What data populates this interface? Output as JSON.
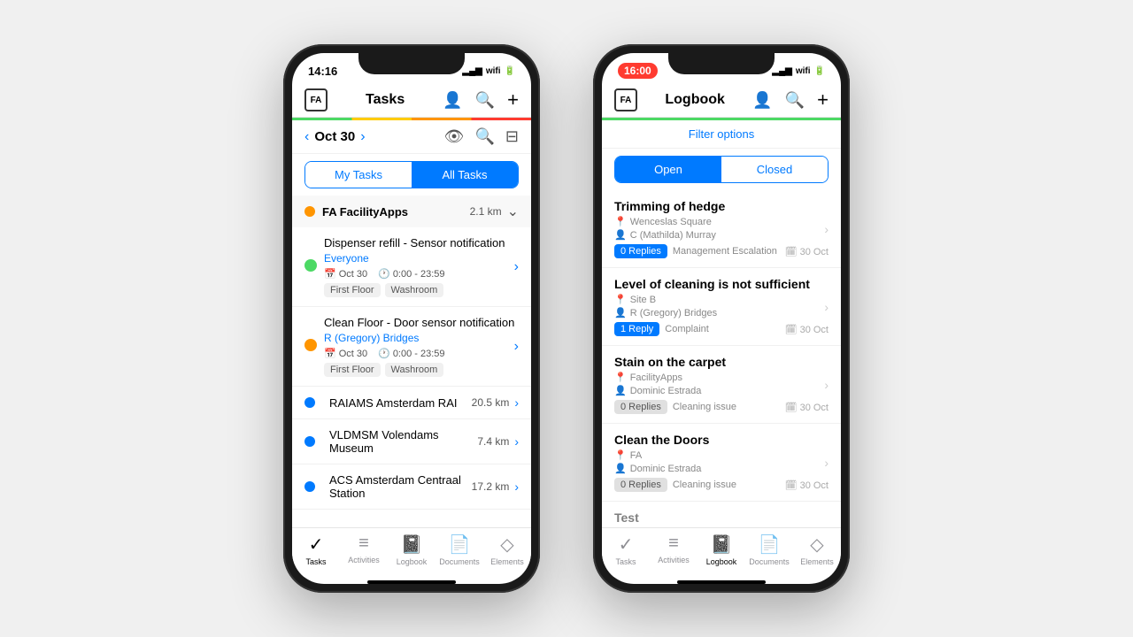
{
  "phone1": {
    "statusBar": {
      "time": "14:16",
      "signal": "●●●",
      "wifi": "wifi",
      "battery": "battery"
    },
    "nav": {
      "title": "Tasks",
      "logo": "FA"
    },
    "dateNav": {
      "date": "Oct 30",
      "prevArrow": "‹",
      "nextArrow": "›"
    },
    "tabs": {
      "myTasks": "My Tasks",
      "allTasks": "All Tasks"
    },
    "locationGroup": {
      "name": "FA FacilityApps",
      "distance": "2.1 km",
      "dotColor": "#ff9500"
    },
    "tasks": [
      {
        "title": "Dispenser refill - Sensor notification",
        "assignee": "Everyone",
        "date": "Oct 30",
        "time": "0:00 - 23:59",
        "tags": [
          "First Floor",
          "Washroom"
        ],
        "dotColor": "#4cd964"
      },
      {
        "title": "Clean Floor - Door sensor notification",
        "assignee": "R (Gregory) Bridges",
        "date": "Oct 30",
        "time": "0:00 - 23:59",
        "tags": [
          "First Floor",
          "Washroom"
        ],
        "dotColor": "#ff9500"
      }
    ],
    "otherLocations": [
      {
        "name": "RAIAMS Amsterdam RAI",
        "distance": "20.5 km",
        "dotColor": "#007aff"
      },
      {
        "name": "VLDMSM Volendams Museum",
        "distance": "7.4 km",
        "dotColor": "#007aff"
      },
      {
        "name": "ACS Amsterdam Centraal Station",
        "distance": "17.2 km",
        "dotColor": "#007aff"
      }
    ],
    "tabBar": {
      "items": [
        {
          "label": "Tasks",
          "active": true
        },
        {
          "label": "Activities",
          "active": false
        },
        {
          "label": "Logbook",
          "active": false
        },
        {
          "label": "Documents",
          "active": false
        },
        {
          "label": "Elements",
          "active": false
        }
      ]
    }
  },
  "phone2": {
    "statusBar": {
      "time": "16:00",
      "isPill": true
    },
    "nav": {
      "title": "Logbook",
      "logo": "FA"
    },
    "filterOptions": "Filter options",
    "tabs": {
      "open": "Open",
      "closed": "Closed"
    },
    "logbookItems": [
      {
        "title": "Trimming of hedge",
        "location": "Wenceslas Square",
        "assignee": "C (Mathilda) Murray",
        "repliesLabel": "0 Replies",
        "repliesType": "blue",
        "category": "Management Escalation",
        "date": "30 Oct"
      },
      {
        "title": "Level of cleaning is not sufficient",
        "location": "Site B",
        "assignee": "R (Gregory) Bridges",
        "repliesLabel": "1 Reply",
        "repliesType": "blue",
        "category": "Complaint",
        "date": "30 Oct"
      },
      {
        "title": "Stain on the carpet",
        "location": "FacilityApps",
        "assignee": "Dominic Estrada",
        "repliesLabel": "0 Replies",
        "repliesType": "gray",
        "category": "Cleaning issue",
        "date": "30 Oct"
      },
      {
        "title": "Clean the Doors",
        "location": "FA",
        "assignee": "Dominic Estrada",
        "repliesLabel": "0 Replies",
        "repliesType": "gray",
        "category": "Cleaning issue",
        "date": "30 Oct"
      },
      {
        "title": "Test",
        "location": "",
        "assignee": "",
        "repliesLabel": "",
        "repliesType": "gray",
        "category": "",
        "date": ""
      }
    ],
    "tabBar": {
      "items": [
        {
          "label": "Tasks",
          "active": false
        },
        {
          "label": "Activities",
          "active": false
        },
        {
          "label": "Logbook",
          "active": true
        },
        {
          "label": "Documents",
          "active": false
        },
        {
          "label": "Elements",
          "active": false
        }
      ]
    }
  },
  "icons": {
    "person": "👤",
    "search": "🔍",
    "plus": "+",
    "eye": "👁",
    "filter": "⊟",
    "calendar": "📅",
    "clock": "🕐",
    "chevronRight": "›",
    "chevronLeft": "‹",
    "chevronDown": "⌄",
    "locationPin": "📍",
    "locationDot": "◉",
    "tasks": "✓",
    "activities": "≡",
    "logbook": "📓",
    "documents": "📄",
    "elements": "◇"
  }
}
